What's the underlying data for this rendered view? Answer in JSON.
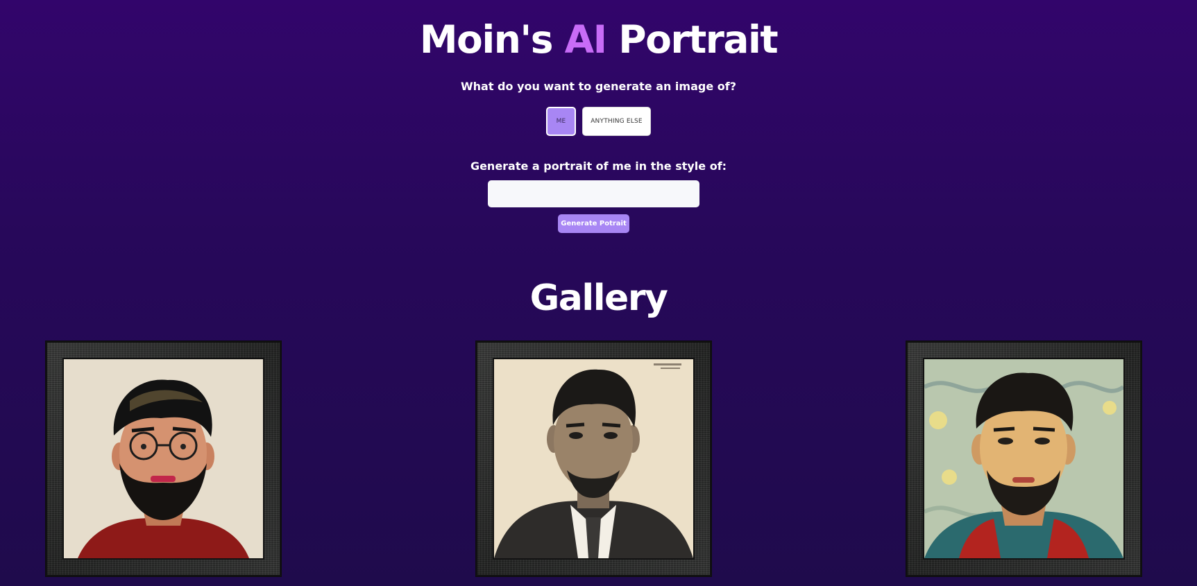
{
  "header": {
    "title_part1": "Moin's ",
    "title_accent": "AI",
    "title_part2": " Portrait",
    "accent_color": "#c86cf7"
  },
  "form": {
    "question": "What do you want to generate an image of?",
    "options": [
      "ME",
      "ANYTHING ELSE"
    ],
    "selected_option": "ME",
    "style_label": "Generate a portrait of me in the style of:",
    "style_input_value": "",
    "generate_label": "Generate Potrait"
  },
  "gallery": {
    "title": "Gallery"
  },
  "colors": {
    "background_top": "#32056b",
    "background_bottom": "#1f0b4c",
    "button_primary": "#a886f4"
  }
}
